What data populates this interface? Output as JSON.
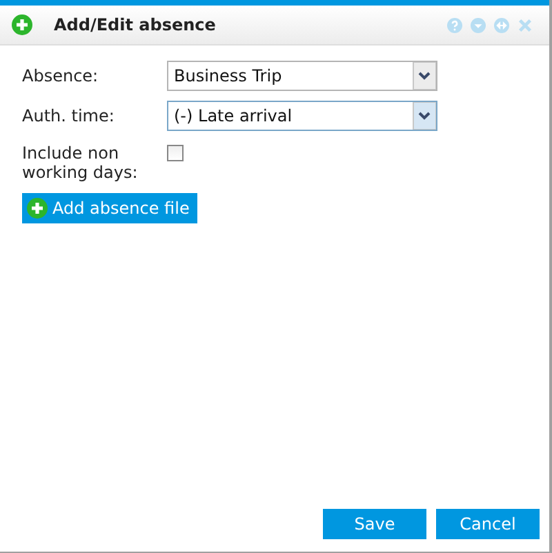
{
  "window": {
    "title": "Add/Edit absence"
  },
  "fields": [
    {
      "label": "Absence:",
      "value": "Business Trip",
      "focused": false
    },
    {
      "label": "Auth. time:",
      "value": "(-) Late arrival",
      "focused": true
    }
  ],
  "checkbox": {
    "label": "Include non working days:",
    "checked": false
  },
  "add_button": "Add absence file",
  "buttons": [
    "Save",
    "Cancel"
  ]
}
